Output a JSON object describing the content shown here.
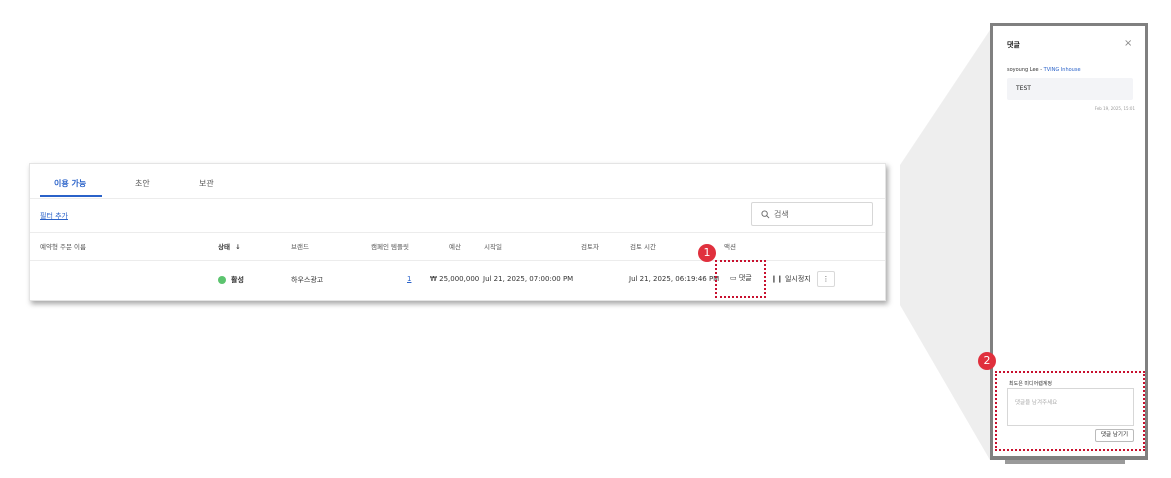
{
  "tabs": [
    {
      "label": "이용 가능",
      "active": true
    },
    {
      "label": "초안",
      "active": false
    },
    {
      "label": "보관",
      "active": false
    }
  ],
  "filter_link": "필터 추가",
  "search": {
    "placeholder": "검색",
    "icon": "search-icon"
  },
  "table": {
    "headers": {
      "name": "예약형 주문 이름",
      "status": "상태",
      "status_sort": "↓",
      "brand": "브랜드",
      "campaign_templates": "캠페인 템플릿",
      "budget": "예산",
      "start_date": "시작일",
      "reviewer": "검토자",
      "review_time": "검토 시간",
      "actions": "액션"
    },
    "rows": [
      {
        "name": "",
        "status": "활성",
        "status_color": "#5cc46f",
        "brand": "하우스광고",
        "campaign_templates": "1",
        "budget": "₩ 25,000,000",
        "start_date": "Jul 21, 2025, 07:00:00 PM",
        "reviewer": "",
        "review_time": "Jul 21, 2025, 06:19:46 PM",
        "actions": {
          "comment": "댓글",
          "pause": "일시정지",
          "more": "⋮"
        }
      }
    ]
  },
  "callouts": {
    "one": "1",
    "two": "2",
    "color": "#c8102e"
  },
  "comment_panel": {
    "title": "댓글",
    "close": "×",
    "comments": [
      {
        "author": "soyoung Lee",
        "org": "TVING Inhouse",
        "text": "TEST",
        "time": "Feb 19, 2025, 15:01"
      }
    ],
    "current_user": "최도은 미디어렙계정",
    "input_placeholder": "댓글을 남겨주세요",
    "submit": "댓글 남기기"
  },
  "colors": {
    "accent": "#2a62c9",
    "active_status": "#5cc46f",
    "callout": "#e0303d"
  }
}
